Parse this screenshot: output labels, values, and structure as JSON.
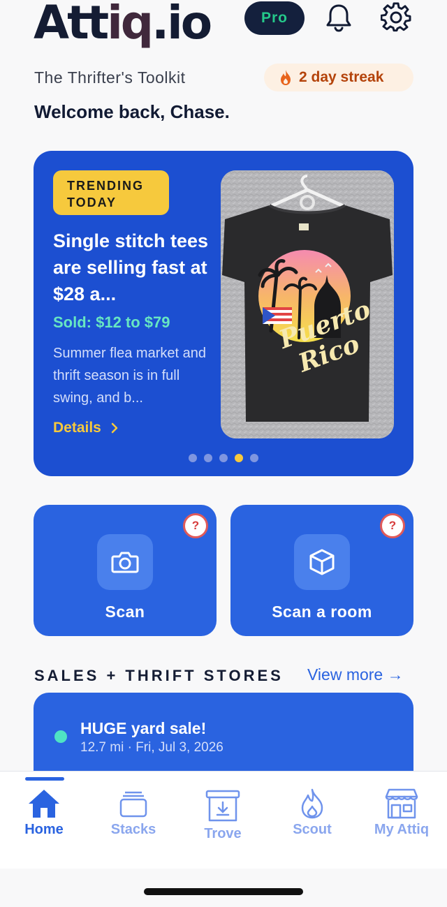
{
  "header": {
    "logo_main": "Attiq",
    "logo_suffix": ".io",
    "pro_badge": "Pro",
    "tagline": "The Thrifter's Toolkit",
    "streak": "2 day streak",
    "welcome": "Welcome back, Chase."
  },
  "trending": {
    "tag": "TRENDING TODAY",
    "title": "Single stitch tees are selling fast at $28 a...",
    "sold": "Sold: $12 to $79",
    "description": "Summer flea market and thrift season is in full swing, and b...",
    "details_label": "Details",
    "shirt_text_line1": "Puerto",
    "shirt_text_line2": "Rico",
    "carousel_count": 5,
    "carousel_active_index": 3
  },
  "actions": [
    {
      "label": "Scan",
      "icon": "camera-icon",
      "help": "?"
    },
    {
      "label": "Scan a room",
      "icon": "cube-icon",
      "help": "?"
    }
  ],
  "sales_section": {
    "title": "SALES + THRIFT STORES",
    "view_more": "View more →",
    "items": [
      {
        "title": "HUGE yard sale!",
        "meta": "12.7 mi · Fri, Jul 3, 2026"
      }
    ]
  },
  "tabs": [
    {
      "label": "Home",
      "icon": "home-icon",
      "active": true
    },
    {
      "label": "Stacks",
      "icon": "stacks-icon",
      "active": false
    },
    {
      "label": "Trove",
      "icon": "trove-icon",
      "active": false
    },
    {
      "label": "Scout",
      "icon": "flame-icon",
      "active": false
    },
    {
      "label": "My Attiq",
      "icon": "storefront-icon",
      "active": false
    }
  ],
  "colors": {
    "brand_blue": "#2a63e0",
    "card_blue": "#1c4fd1",
    "accent_yellow": "#f6c93d",
    "accent_mint": "#67e6c2",
    "pro_green": "#25c98a"
  }
}
